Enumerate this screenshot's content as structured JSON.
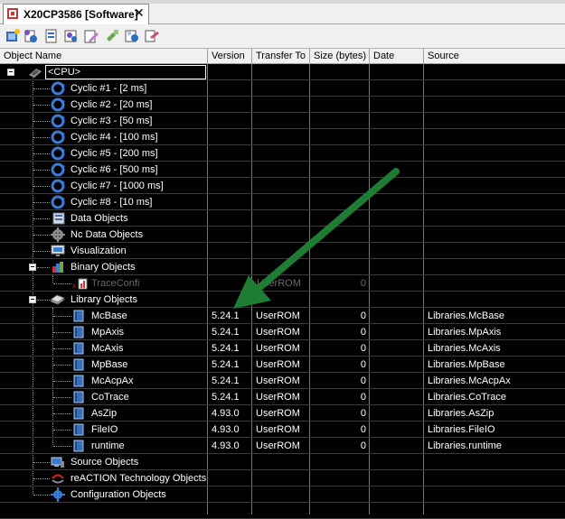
{
  "tab": {
    "title": "X20CP3586 [Software]",
    "close": "✕"
  },
  "toolbar": {
    "buttons": [
      "new-object-icon",
      "insert-icon",
      "properties-icon",
      "open-icon",
      "edit-icon",
      "build-icon",
      "transfer-icon",
      "delete-icon"
    ]
  },
  "columns": {
    "name": "Object Name",
    "version": "Version",
    "transfer": "Transfer To",
    "size": "Size (bytes)",
    "date": "Date",
    "source": "Source"
  },
  "root": {
    "label": "<CPU>"
  },
  "cyclics": [
    {
      "label": "Cyclic #1 - [2 ms]"
    },
    {
      "label": "Cyclic #2 - [20 ms]"
    },
    {
      "label": "Cyclic #3 - [50 ms]"
    },
    {
      "label": "Cyclic #4 - [100 ms]"
    },
    {
      "label": "Cyclic #5 - [200 ms]"
    },
    {
      "label": "Cyclic #6 - [500 ms]"
    },
    {
      "label": "Cyclic #7 - [1000 ms]"
    },
    {
      "label": "Cyclic #8 - [10 ms]"
    }
  ],
  "nodes": {
    "data_objects": "Data Objects",
    "nc_data_objects": "Nc Data Objects",
    "visualization": "Visualization",
    "binary_objects": "Binary Objects",
    "trace": {
      "label": "TraceConfi",
      "transfer": "UserROM",
      "size": "0"
    },
    "library_objects": "Library Objects",
    "source_objects": "Source Objects",
    "reaction": "reACTION Technology Objects",
    "configuration": "Configuration Objects"
  },
  "libraries": [
    {
      "name": "McBase",
      "version": "5.24.1",
      "transfer": "UserROM",
      "size": "0",
      "source": "Libraries.McBase"
    },
    {
      "name": "MpAxis",
      "version": "5.24.1",
      "transfer": "UserROM",
      "size": "0",
      "source": "Libraries.MpAxis"
    },
    {
      "name": "McAxis",
      "version": "5.24.1",
      "transfer": "UserROM",
      "size": "0",
      "source": "Libraries.McAxis"
    },
    {
      "name": "MpBase",
      "version": "5.24.1",
      "transfer": "UserROM",
      "size": "0",
      "source": "Libraries.MpBase"
    },
    {
      "name": "McAcpAx",
      "version": "5.24.1",
      "transfer": "UserROM",
      "size": "0",
      "source": "Libraries.McAcpAx"
    },
    {
      "name": "CoTrace",
      "version": "5.24.1",
      "transfer": "UserROM",
      "size": "0",
      "source": "Libraries.CoTrace"
    },
    {
      "name": "AsZip",
      "version": "4.93.0",
      "transfer": "UserROM",
      "size": "0",
      "source": "Libraries.AsZip"
    },
    {
      "name": "FileIO",
      "version": "4.93.0",
      "transfer": "UserROM",
      "size": "0",
      "source": "Libraries.FileIO"
    },
    {
      "name": "runtime",
      "version": "4.93.0",
      "transfer": "UserROM",
      "size": "0",
      "source": "Libraries.runtime"
    }
  ],
  "colors": {
    "arrow": "#1e7d32",
    "grid_bg": "#000000",
    "cyclic_icon": "#3a7bd5"
  }
}
